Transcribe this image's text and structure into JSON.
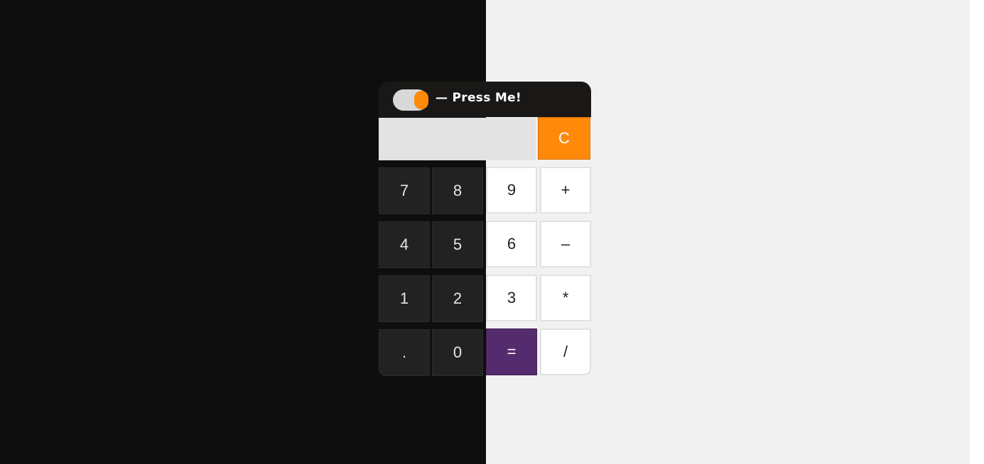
{
  "header": {
    "label": "— Press Me!"
  },
  "display": {
    "value": ""
  },
  "clear_label": "C",
  "keys": {
    "k7": "7",
    "k8": "8",
    "k9": "9",
    "plus": "+",
    "k4": "4",
    "k5": "5",
    "k6": "6",
    "minus": "–",
    "k1": "1",
    "k2": "2",
    "k3": "3",
    "multiply": "*",
    "dot": ".",
    "k0": "0",
    "equals": "=",
    "divide": "/"
  },
  "colors": {
    "accent_orange": "#ff8a0a",
    "equals_purple": "#542c6e",
    "dark_key": "#222222",
    "light_key": "#ffffff",
    "left_background": "#0e0e0e",
    "right_background": "#f1f1f1"
  }
}
